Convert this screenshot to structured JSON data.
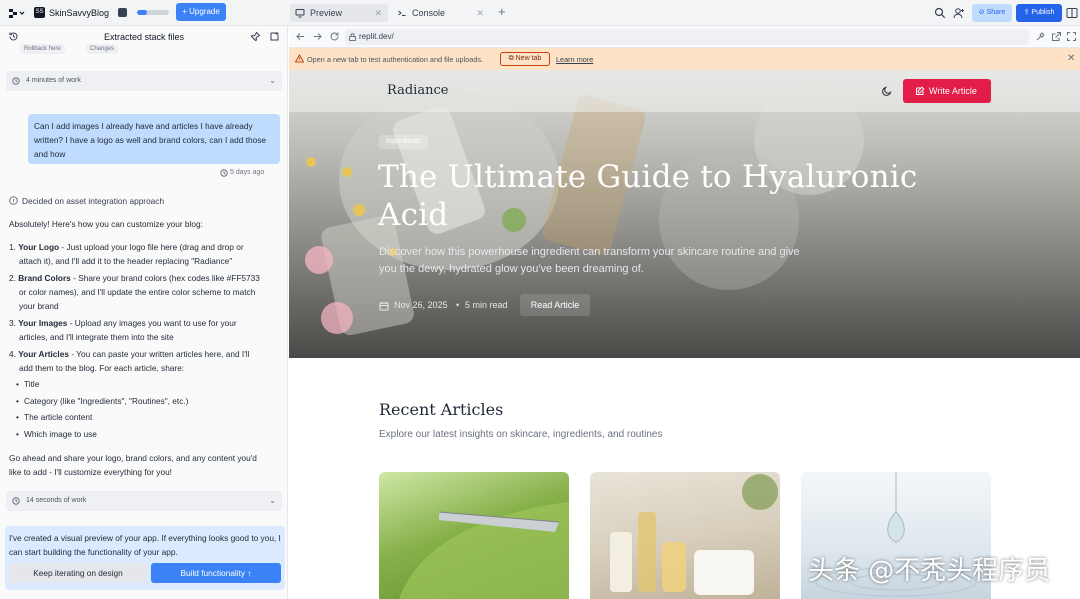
{
  "topbar": {
    "project_name": "SkinSavvyBlog",
    "project_initials": "SS",
    "usage_fraction": 0.3,
    "upgrade_label": "Upgrade",
    "tabs": [
      {
        "label": "Preview",
        "icon": "monitor-icon"
      },
      {
        "label": "Console",
        "icon": "terminal-icon"
      }
    ],
    "share_label": "Share",
    "publish_label": "Publish"
  },
  "chat": {
    "title": "Extracted stack files",
    "chips": [
      "Rollback here",
      "Changes"
    ],
    "work_rows": [
      "4 minutes of work",
      "14 seconds of work"
    ],
    "user_message": "Can I add images I already have and articles I have already written? I have a logo as well and brand colors, can I add those and how",
    "timestamp": "5 days ago",
    "decided": "Decided on asset integration approach",
    "intro": "Absolutely! Here's how you can customize your blog:",
    "steps": [
      {
        "n": "1.",
        "bold": "Your Logo",
        "text": " - Just upload your logo file here (drag and drop or",
        "text2": "attach it), and I'll add it to the header replacing \"Radiance\""
      },
      {
        "n": "2.",
        "bold": "Brand Colors",
        "text": " - Share your brand colors (hex codes like #FF5733",
        "text2": "or color names), and I'll update the entire color scheme to match",
        "text3": "your brand"
      },
      {
        "n": "3.",
        "bold": "Your Images",
        "text": " - Upload any images you want to use for your",
        "text2": "articles, and I'll integrate them into the site"
      },
      {
        "n": "4.",
        "bold": "Your Articles",
        "text": " - You can paste your written articles here, and I'll",
        "text2": "add them to the blog. For each article, share:"
      }
    ],
    "bullets": [
      "Title",
      "Category (like \"Ingredients\", \"Routines\", etc.)",
      "The article content",
      "Which image to use"
    ],
    "closing1": "Go ahead and share your logo, brand colors, and any content you'd",
    "closing2": "like to add - I'll customize everything for you!",
    "info_text": "I've created a visual preview of your app. If everything looks good to you, I can start building the functionality of your app.",
    "keep_label": "Keep iterating on design",
    "build_label": "Build functionality"
  },
  "preview": {
    "url": "replit.dev/",
    "warning": "Open a new tab to test authentication and file uploads.",
    "new_tab_label": "New tab",
    "learn_more": "Learn more",
    "site": {
      "brand": "Radiance",
      "write_label": "Write Article",
      "hero_tag": "Ingredients",
      "hero_title": "The Ultimate Guide to Hyaluronic Acid",
      "hero_desc": "Discover how this powerhouse ingredient can transform your skincare routine and give you the dewy, hydrated glow you've been dreaming of.",
      "hero_date": "Nov 26, 2025",
      "hero_read": "5 min read",
      "read_label": "Read Article",
      "recent_title": "Recent Articles",
      "recent_sub": "Explore our latest insights on skincare, ingredients, and routines"
    }
  },
  "watermark": "头条 @不秃头程序员",
  "colors": {
    "accent": "#3b82f6",
    "brand_red": "#e11d48",
    "warn_bg": "#fde2c5"
  }
}
